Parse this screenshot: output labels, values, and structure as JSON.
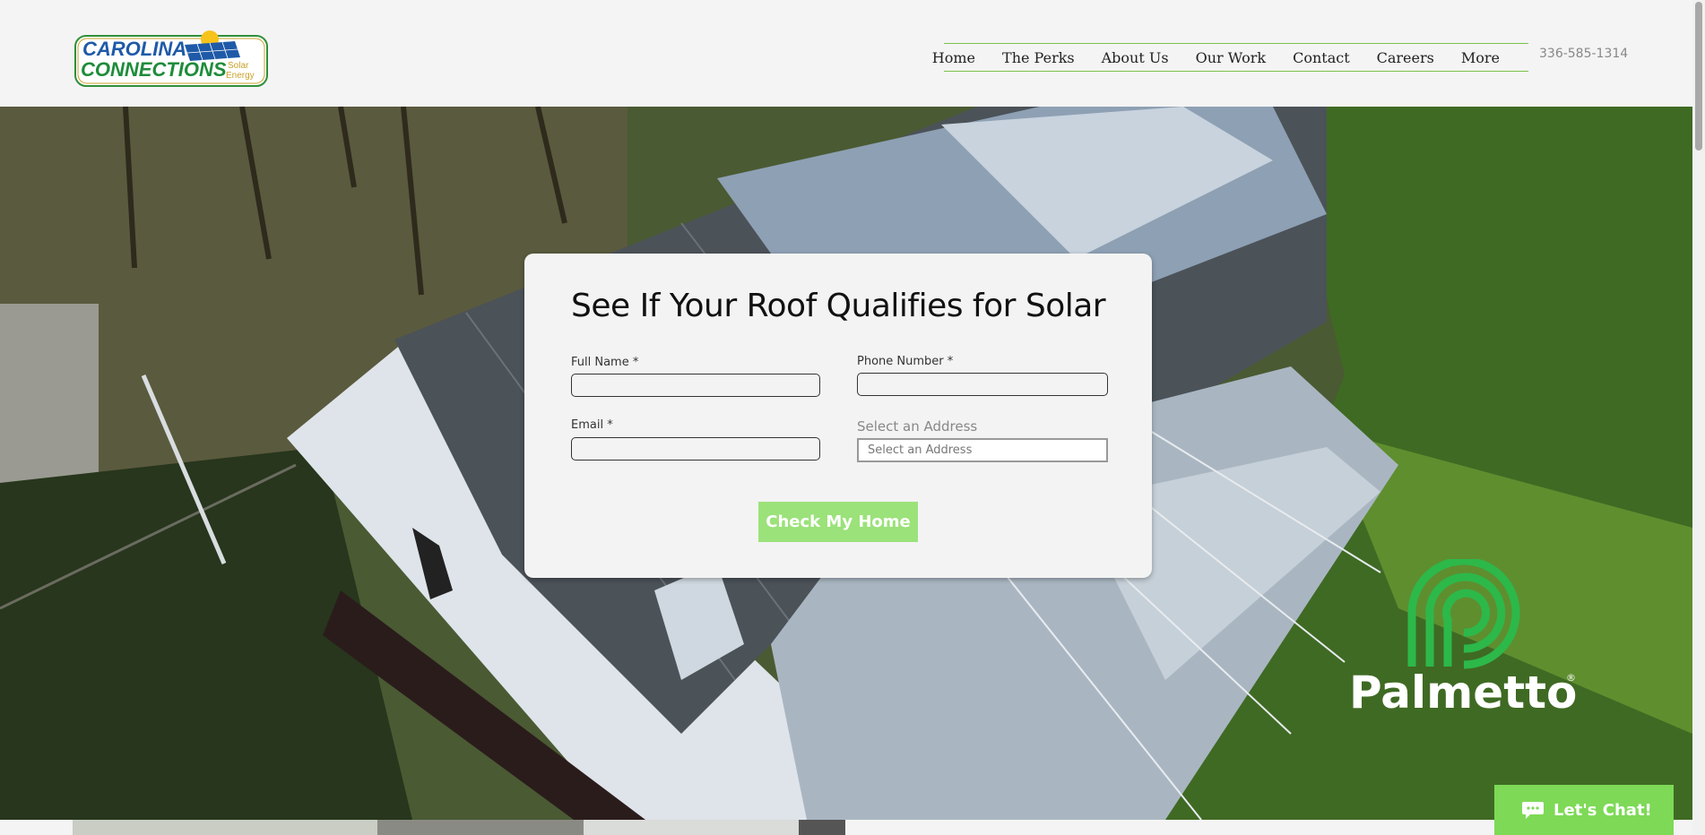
{
  "brand": {
    "logo_line1": "CAROLINA",
    "logo_line2": "CONNECTIONS",
    "logo_sub1": "Solar",
    "logo_sub2": "Energy"
  },
  "nav": {
    "items": [
      "Home",
      "The Perks",
      "About Us",
      "Our Work",
      "Contact",
      "Careers",
      "More"
    ]
  },
  "header": {
    "phone": "336-585-1314"
  },
  "form": {
    "title": "See If Your Roof Qualifies for Solar",
    "full_name_label": "Full Name *",
    "phone_label": "Phone Number *",
    "email_label": "Email *",
    "address_label": "Select an Address",
    "address_placeholder": "Select an Address",
    "submit_label": "Check My Home"
  },
  "partner": {
    "name": "Palmetto",
    "mark": "®"
  },
  "chat": {
    "label": "Let's Chat!"
  },
  "colors": {
    "accent_green": "#7ed957",
    "button_green": "#9be27a",
    "nav_line": "#7cc24a",
    "logo_green": "#1e8c3a",
    "logo_blue": "#1f5aa8"
  }
}
